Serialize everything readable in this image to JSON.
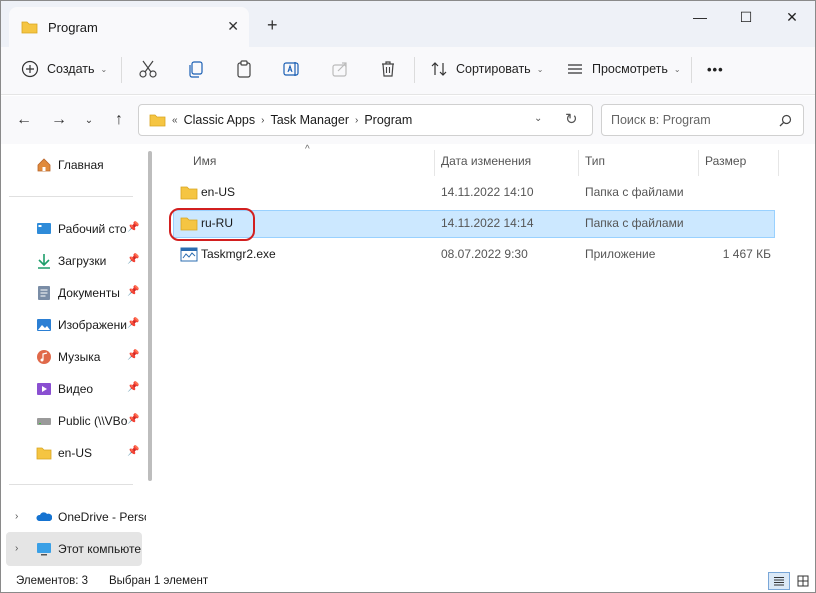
{
  "window": {
    "tab_title": "Program",
    "tab_close": "✕",
    "new_tab": "+",
    "minimize": "—",
    "maximize": "☐",
    "close": "✕"
  },
  "toolbar": {
    "create_label": "Создать",
    "sort_label": "Сортировать",
    "view_label": "Просмотреть",
    "more_label": "•••"
  },
  "navigation": {
    "breadcrumb_overflow": "«",
    "breadcrumbs": [
      "Classic Apps",
      "Task Manager",
      "Program"
    ],
    "search_placeholder": "Поиск в: Program"
  },
  "sidebar": {
    "items": [
      {
        "label": "Главная",
        "icon": "home-icon"
      },
      {
        "label": "Рабочий сто",
        "icon": "desktop-icon",
        "pinned": true
      },
      {
        "label": "Загрузки",
        "icon": "download-icon",
        "pinned": true
      },
      {
        "label": "Документы",
        "icon": "documents-icon",
        "pinned": true
      },
      {
        "label": "Изображени",
        "icon": "pictures-icon",
        "pinned": true
      },
      {
        "label": "Музыка",
        "icon": "music-icon",
        "pinned": true
      },
      {
        "label": "Видео",
        "icon": "video-icon",
        "pinned": true
      },
      {
        "label": "Public (\\\\VBo",
        "icon": "network-drive-icon",
        "pinned": true
      },
      {
        "label": "en-US",
        "icon": "folder-icon",
        "pinned": true
      },
      {
        "label": "OneDrive - Perso",
        "icon": "onedrive-icon"
      },
      {
        "label": "Этот компьюте",
        "icon": "this-pc-icon"
      }
    ]
  },
  "columns": {
    "name": "Имя",
    "modified": "Дата изменения",
    "type": "Тип",
    "size": "Размер"
  },
  "files": [
    {
      "name": "en-US",
      "modified": "14.11.2022 14:10",
      "type": "Папка с файлами",
      "size": "",
      "icon": "folder-icon"
    },
    {
      "name": "ru-RU",
      "modified": "14.11.2022 14:14",
      "type": "Папка с файлами",
      "size": "",
      "icon": "folder-icon",
      "selected": true
    },
    {
      "name": "Taskmgr2.exe",
      "modified": "08.07.2022 9:30",
      "type": "Приложение",
      "size": "1 467 КБ",
      "icon": "exe-icon"
    }
  ],
  "status": {
    "count": "Элементов: 3",
    "selected": "Выбран 1 элемент"
  },
  "colors": {
    "accent": "#0067c0",
    "selection": "#cce8ff",
    "highlight_ring": "#d21f1f",
    "folder": "#f5c542"
  }
}
